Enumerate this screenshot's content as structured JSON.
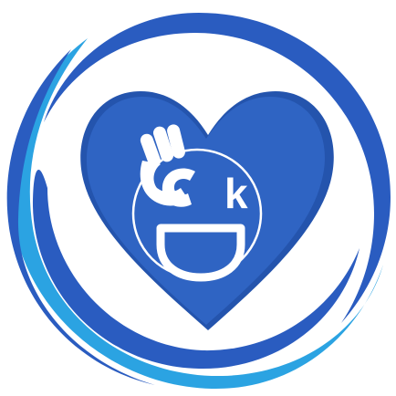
{
  "logo": {
    "letters": [
      "c",
      "k"
    ],
    "colors": {
      "heart": "#2f64c3",
      "heart_shadow": "#2454ad",
      "ring_dark": "#2a5cc0",
      "ring_light": "#2ba3e2",
      "foreground": "#ffffff",
      "background": "#ffffff"
    },
    "icons": [
      "heart-icon",
      "ok-hand-icon",
      "smiley-face-icon"
    ]
  }
}
